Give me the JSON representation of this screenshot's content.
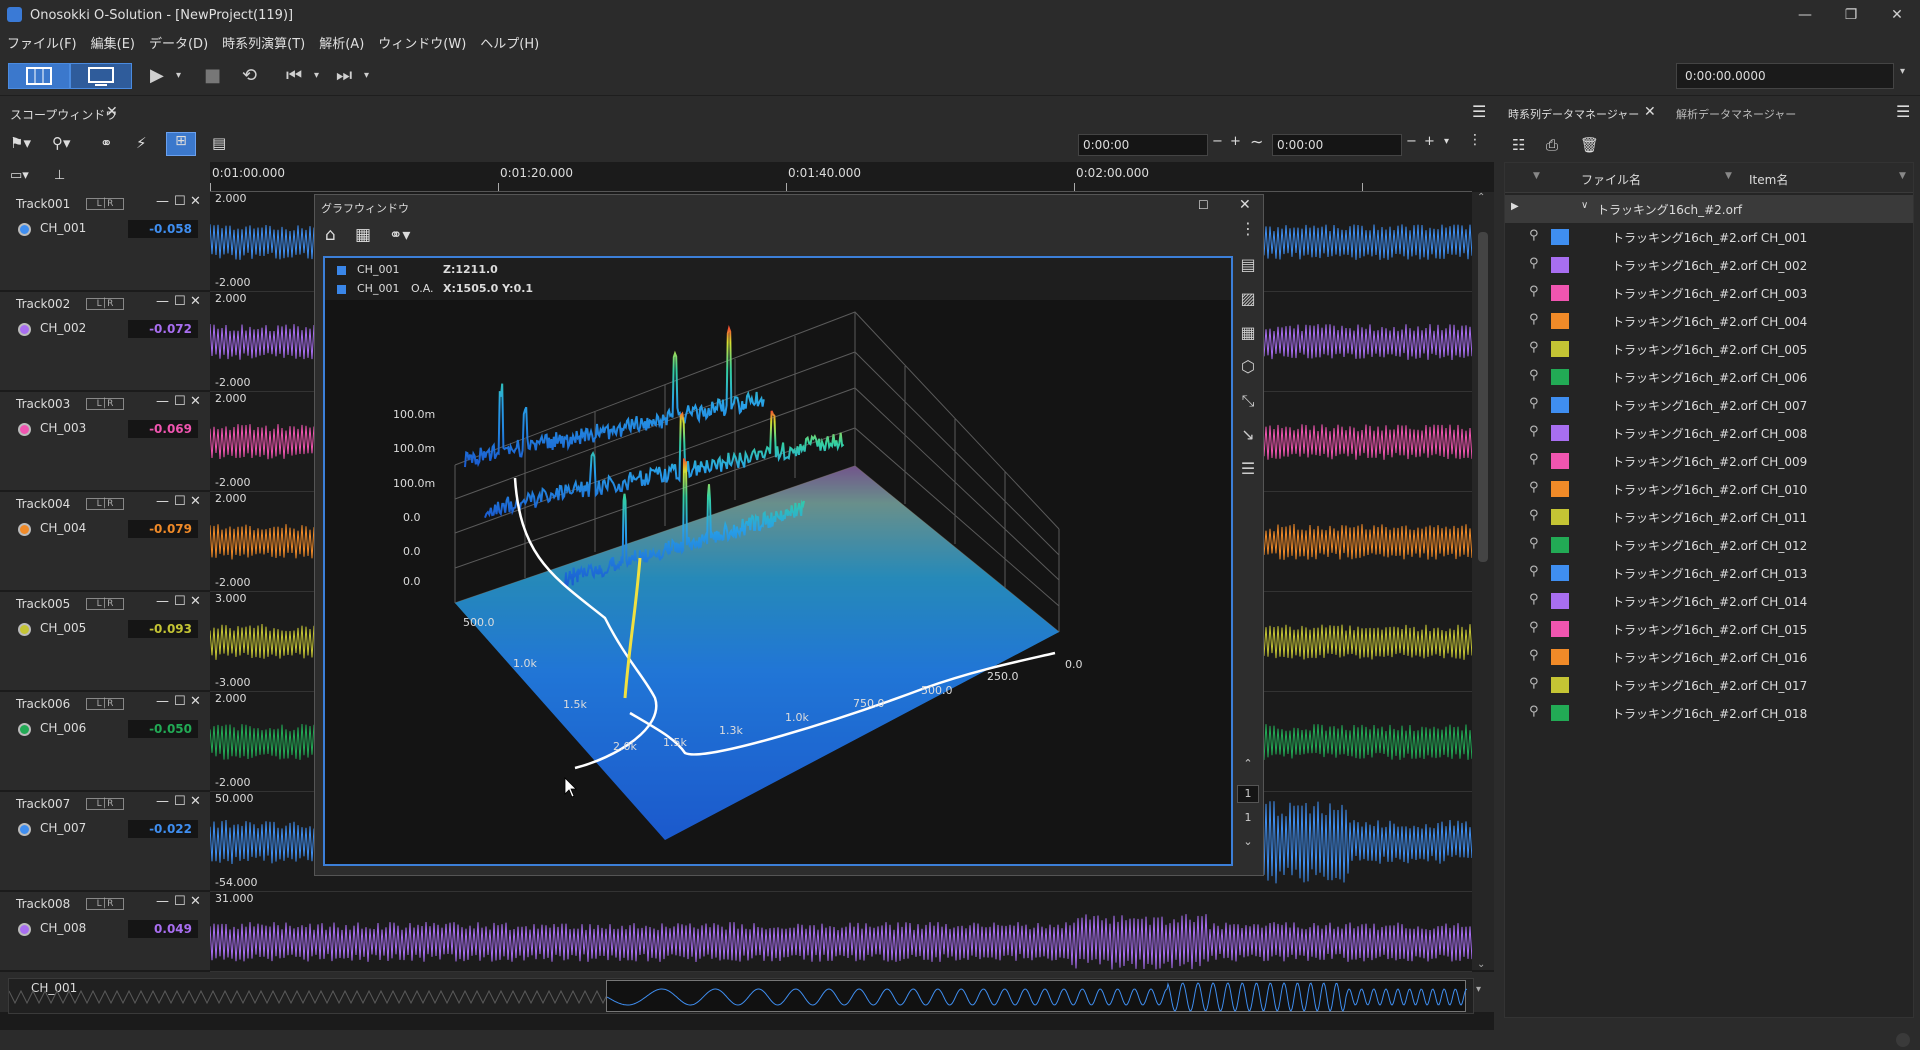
{
  "window": {
    "title": "Onosokki O-Solution - [NewProject(119)]"
  },
  "menu": [
    "ファイル(F)",
    "編集(E)",
    "データ(D)",
    "時系列演算(T)",
    "解析(A)",
    "ウィンドウ(W)",
    "ヘルプ(H)"
  ],
  "toolbar": {
    "time": "0:00:00.0000"
  },
  "scope": {
    "tab": "スコープウィンドウ",
    "start_time": "0:00:00",
    "end_time": "0:00:00",
    "ruler": [
      "0:01:00.000",
      "0:01:20.000",
      "0:01:40.000",
      "0:02:00.000"
    ],
    "tracks": [
      {
        "name": "Track001",
        "ch": "CH_001",
        "value": "-0.058",
        "color": "#3f8ef0",
        "ytop": "2.000",
        "ybot": "-2.000"
      },
      {
        "name": "Track002",
        "ch": "CH_002",
        "value": "-0.072",
        "color": "#a86ef0",
        "ytop": "2.000",
        "ybot": "-2.000"
      },
      {
        "name": "Track003",
        "ch": "CH_003",
        "value": "-0.069",
        "color": "#f055b0",
        "ytop": "2.000",
        "ybot": "-2.000"
      },
      {
        "name": "Track004",
        "ch": "CH_004",
        "value": "-0.079",
        "color": "#f08a28",
        "ytop": "2.000",
        "ybot": "-2.000"
      },
      {
        "name": "Track005",
        "ch": "CH_005",
        "value": "-0.093",
        "color": "#c4c434",
        "ytop": "3.000",
        "ybot": "-3.000"
      },
      {
        "name": "Track006",
        "ch": "CH_006",
        "value": "-0.050",
        "color": "#22aa55",
        "ytop": "2.000",
        "ybot": "-2.000"
      },
      {
        "name": "Track007",
        "ch": "CH_007",
        "value": "-0.022",
        "color": "#3f8ef0",
        "ytop": "50.000",
        "ybot": "-54.000"
      },
      {
        "name": "Track008",
        "ch": "CH_008",
        "value": "0.049",
        "color": "#a86ef0",
        "ytop": "31.000",
        "ybot": ""
      }
    ],
    "overview_label": "CH_001"
  },
  "graph": {
    "title": "グラフウィンドウ",
    "legend1_ch": "CH_001",
    "legend1_val": "Z:1211.0",
    "legend2_ch": "CH_001",
    "legend2_tag": "O.A.",
    "legend2_val": "X:1505.0 Y:0.1",
    "zlabels": [
      "100.0m",
      "100.0m",
      "100.0m",
      "0.0",
      "0.0",
      "0.0"
    ],
    "xlabels_left": [
      "500.0",
      "1.0k",
      "1.5k",
      "2.0k"
    ],
    "xlabels_front": [
      "1.5k",
      "1.3k",
      "1.0k",
      "750.0",
      "500.0",
      "250.0",
      "0.0"
    ],
    "page": "1",
    "page2": "1"
  },
  "rpanel": {
    "tab1": "時系列データマネージャー",
    "tab2": "解析データマネージャー",
    "col_file": "ファイル名",
    "col_item": "Item名",
    "group": "トラッキング16ch_#2.orf",
    "rows": [
      {
        "text": "トラッキング16ch_#2.orf CH_001",
        "color": "#3f8ef0"
      },
      {
        "text": "トラッキング16ch_#2.orf CH_002",
        "color": "#a86ef0"
      },
      {
        "text": "トラッキング16ch_#2.orf CH_003",
        "color": "#f055b0"
      },
      {
        "text": "トラッキング16ch_#2.orf CH_004",
        "color": "#f08a28"
      },
      {
        "text": "トラッキング16ch_#2.orf CH_005",
        "color": "#c4c434"
      },
      {
        "text": "トラッキング16ch_#2.orf CH_006",
        "color": "#22aa55"
      },
      {
        "text": "トラッキング16ch_#2.orf CH_007",
        "color": "#3f8ef0"
      },
      {
        "text": "トラッキング16ch_#2.orf CH_008",
        "color": "#a86ef0"
      },
      {
        "text": "トラッキング16ch_#2.orf CH_009",
        "color": "#f055b0"
      },
      {
        "text": "トラッキング16ch_#2.orf CH_010",
        "color": "#f08a28"
      },
      {
        "text": "トラッキング16ch_#2.orf CH_011",
        "color": "#c4c434"
      },
      {
        "text": "トラッキング16ch_#2.orf CH_012",
        "color": "#22aa55"
      },
      {
        "text": "トラッキング16ch_#2.orf CH_013",
        "color": "#3f8ef0"
      },
      {
        "text": "トラッキング16ch_#2.orf CH_014",
        "color": "#a86ef0"
      },
      {
        "text": "トラッキング16ch_#2.orf CH_015",
        "color": "#f055b0"
      },
      {
        "text": "トラッキング16ch_#2.orf CH_016",
        "color": "#f08a28"
      },
      {
        "text": "トラッキング16ch_#2.orf CH_017",
        "color": "#c4c434"
      },
      {
        "text": "トラッキング16ch_#2.orf CH_018",
        "color": "#22aa55"
      }
    ]
  }
}
